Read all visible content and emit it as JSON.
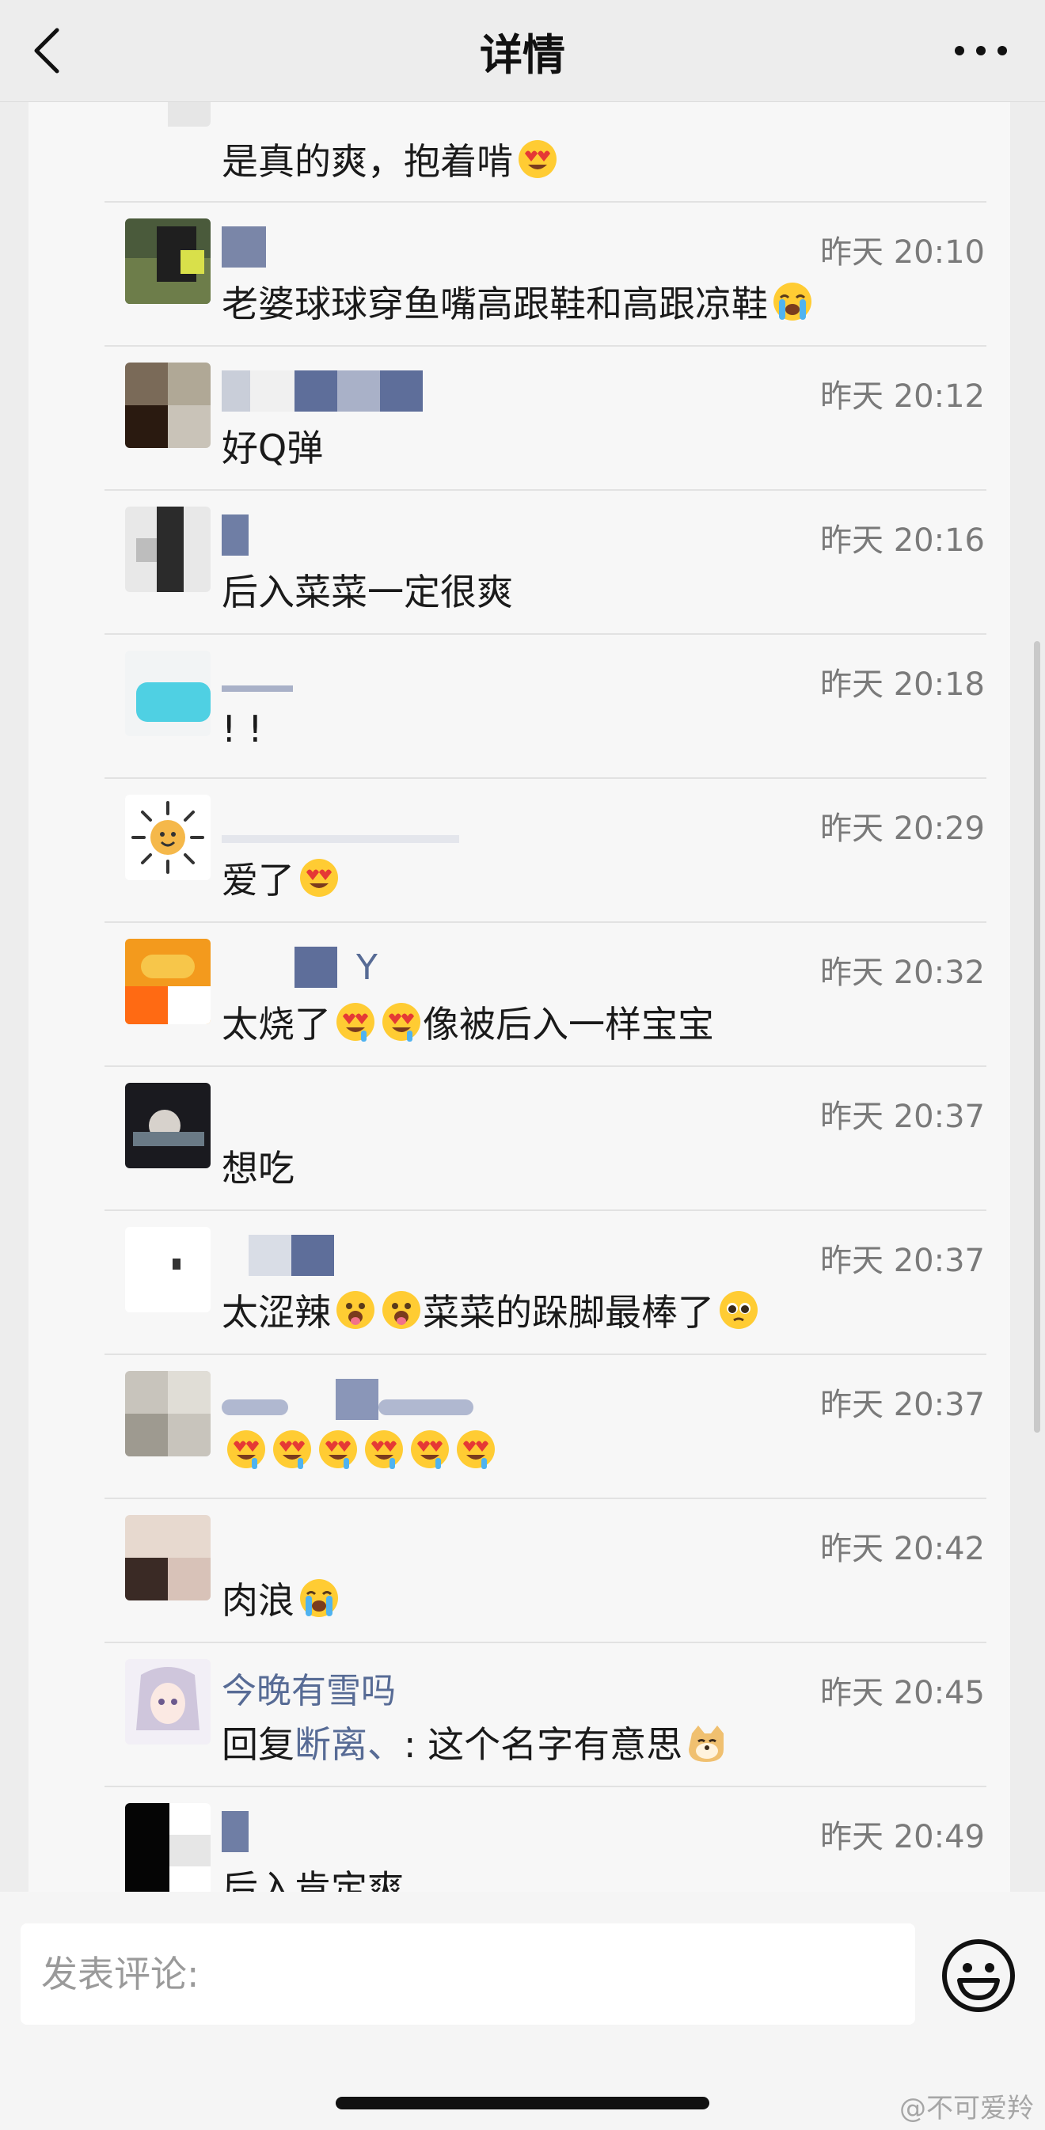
{
  "header": {
    "title": "详情"
  },
  "comments": [
    {
      "username": "",
      "time": "",
      "text": "是真的爽，抱着啃",
      "emojis": [
        "heart-eyes"
      ]
    },
    {
      "username": "",
      "time": "昨天 20:10",
      "text": "老婆球球穿鱼嘴高跟鞋和高跟凉鞋",
      "emojis": [
        "crying"
      ]
    },
    {
      "username": "",
      "time": "昨天 20:12",
      "text": "好Q弹",
      "emojis": []
    },
    {
      "username": "",
      "time": "昨天 20:16",
      "text": "后入菜菜一定很爽",
      "emojis": []
    },
    {
      "username": "",
      "time": "昨天 20:18",
      "text": "! !",
      "emojis": []
    },
    {
      "username": "",
      "time": "昨天 20:29",
      "text": "爱了",
      "emojis": [
        "heart-eyes"
      ]
    },
    {
      "username": "Y",
      "time": "昨天 20:32",
      "text": "太烧了",
      "emojis": [
        "drooling-heart-eyes",
        "drooling-heart-eyes"
      ],
      "text_after": "像被后入一样宝宝"
    },
    {
      "username": "",
      "time": "昨天 20:37",
      "text": "想吃",
      "emojis": []
    },
    {
      "username": "",
      "time": "昨天 20:37",
      "text": "太涩辣",
      "emojis": [
        "tongue",
        "tongue"
      ],
      "text_after": "菜菜的跺脚最棒了",
      "emojis_after": [
        "pleading"
      ]
    },
    {
      "username": "",
      "time": "昨天 20:37",
      "text": "",
      "emojis": [
        "drooling-heart-eyes",
        "drooling-heart-eyes",
        "drooling-heart-eyes",
        "drooling-heart-eyes",
        "drooling-heart-eyes",
        "drooling-heart-eyes"
      ]
    },
    {
      "username": "",
      "time": "昨天 20:42",
      "text": "肉浪",
      "emojis": [
        "crying"
      ]
    },
    {
      "username": "今晚有雪吗",
      "time": "昨天 20:45",
      "reply_prefix": "回复",
      "reply_to": "断离、",
      "text": ": 这个名字有意思",
      "emojis": [
        "doge"
      ]
    },
    {
      "username": "",
      "time": "昨天 20:49",
      "text": "后入肯定爽",
      "emojis": []
    }
  ],
  "input": {
    "placeholder": "发表评论:"
  },
  "watermark": "@不可爱羚",
  "colors": {
    "name": "#576b95",
    "time": "#7a7a7a",
    "panel": "#f7f7f7",
    "bg": "#ededed"
  },
  "icons": [
    "back-arrow-icon",
    "more-icon",
    "emoji-face-icon"
  ]
}
